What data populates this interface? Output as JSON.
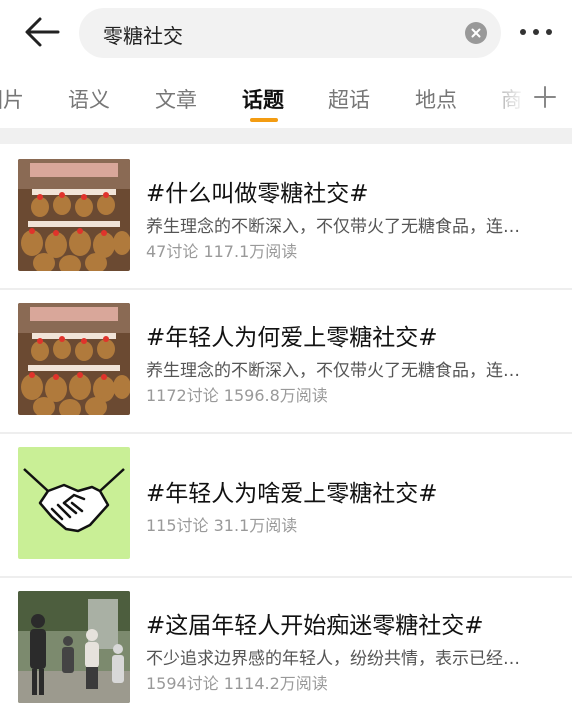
{
  "search": {
    "query": "零糖社交"
  },
  "tabs": [
    {
      "label": "图片"
    },
    {
      "label": "语义"
    },
    {
      "label": "文章"
    },
    {
      "label": "话题",
      "active": true
    },
    {
      "label": "超话"
    },
    {
      "label": "地点"
    },
    {
      "label": "商"
    }
  ],
  "results": [
    {
      "title": "#什么叫做零糖社交#",
      "desc": "养生理念的不断深入，不仅带火了无糖食品，连…",
      "meta": "47讨论 117.1万阅读",
      "thumb": "capybara-plush-stand"
    },
    {
      "title": "#年轻人为何爱上零糖社交#",
      "desc": "养生理念的不断深入，不仅带火了无糖食品，连…",
      "meta": "1172讨论 1596.8万阅读",
      "thumb": "capybara-plush-stand"
    },
    {
      "title": "#年轻人为啥爱上零糖社交#",
      "desc": "",
      "meta": "115讨论 31.1万阅读",
      "thumb": "handshake-illustration"
    },
    {
      "title": "#这届年轻人开始痴迷零糖社交#",
      "desc": "不少追求边界感的年轻人，纷纷共情，表示已经…",
      "meta": "1594讨论 1114.2万阅读",
      "thumb": "people-walking-photo"
    }
  ],
  "colors": {
    "accent": "#f39c12",
    "handshake_bg": "#c9ef96"
  }
}
